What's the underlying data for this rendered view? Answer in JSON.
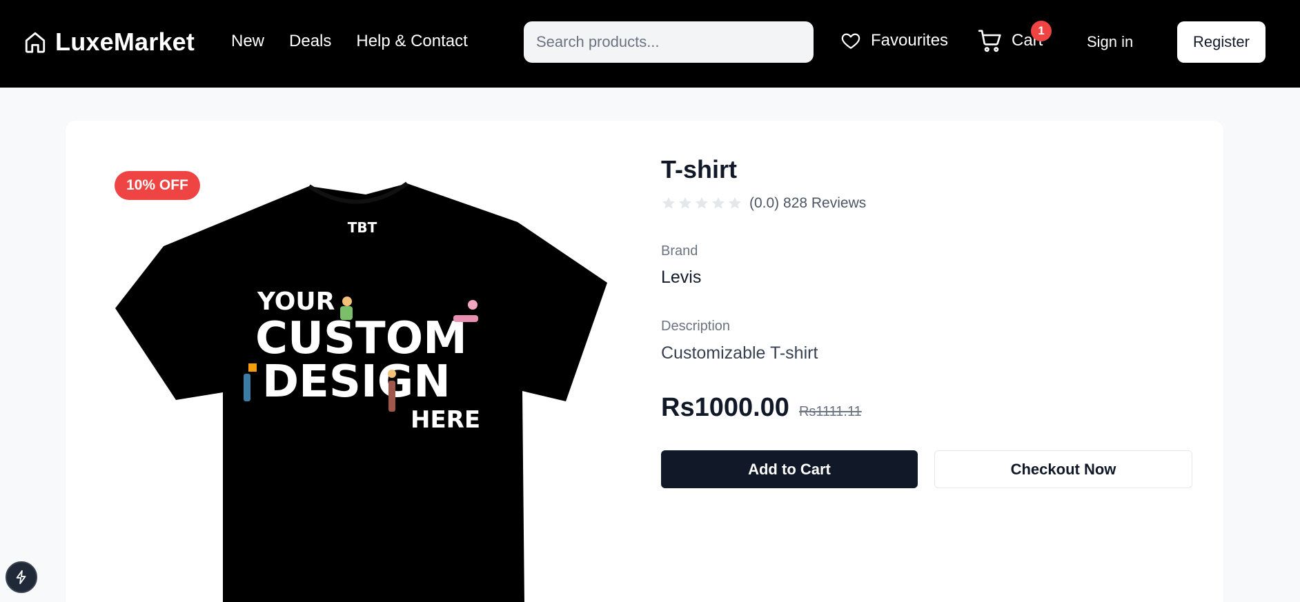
{
  "header": {
    "logo_text": "LuxeMarket",
    "logo_icon": "home-icon",
    "nav": [
      {
        "label": "New"
      },
      {
        "label": "Deals"
      },
      {
        "label": "Help & Contact"
      }
    ],
    "search_placeholder": "Search products...",
    "favourites_label": "Favourites",
    "cart_label": "Cart",
    "cart_count": "1",
    "signin_label": "Sign in",
    "register_label": "Register"
  },
  "product": {
    "discount_badge": "10% OFF",
    "title": "T-shirt",
    "rating_text": "(0.0) 828 Reviews",
    "rating_value": 0,
    "rating_max": 5,
    "brand_label": "Brand",
    "brand": "Levis",
    "description_label": "Description",
    "description": "Customizable T-shirt",
    "price": "Rs1000.00",
    "old_price": "Rs1111.11",
    "add_to_cart_label": "Add to Cart",
    "checkout_label": "Checkout Now",
    "image": {
      "tee_logo": "TBT",
      "line1": "YOUR",
      "line2": "CUSTOM",
      "line3": "DESIGN",
      "line4": "HERE"
    }
  },
  "colors": {
    "header_bg": "#000000",
    "accent_red": "#ef4444",
    "primary_dark": "#111827",
    "page_bg": "#f8f9fb"
  }
}
